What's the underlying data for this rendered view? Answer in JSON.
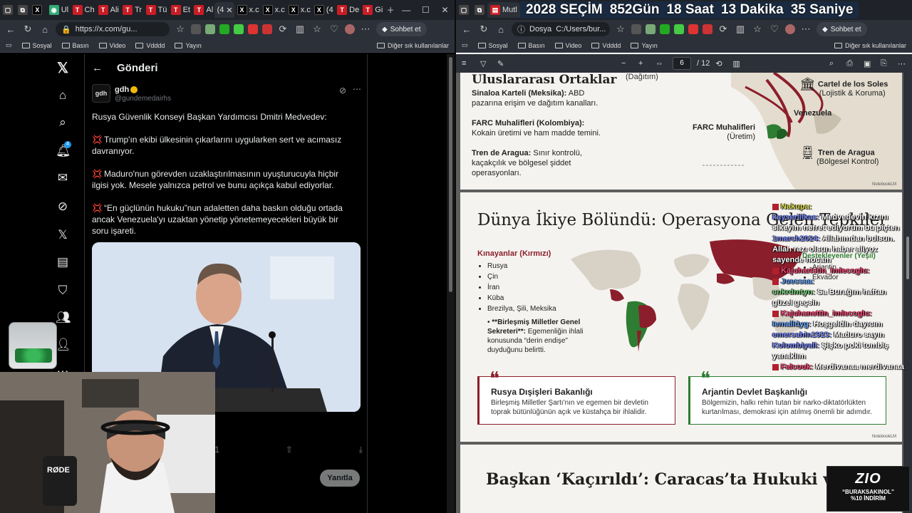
{
  "left_browser": {
    "tabs": [
      "",
      "",
      "Ul",
      "Ch",
      "Ali",
      "Tr",
      "Tü",
      "Et",
      "Al",
      "(4",
      "x.c",
      "x.c",
      "x.c",
      "(4",
      "De",
      "Gi"
    ],
    "address": "https://x.com/gu...",
    "copilot": "Sohbet et",
    "bookmarks": [
      "Sosyal",
      "Basın",
      "Video",
      "Vdddd",
      "Yayın"
    ],
    "bookmarks_other": "Diğer sık kullanılanlar"
  },
  "x_post": {
    "header_title": "Gönderi",
    "avatar_text": "gdh",
    "user_name": "gdh",
    "user_handle": "@gundemedairhs",
    "notification_badge": "4",
    "intro": "Rusya Güvenlik Konseyi Başkan Yardımcısı Dmitri Medvedev:",
    "p1": "Trump'ın ekibi ülkesinin çıkarlarını uygularken sert ve acımasız davranıyor.",
    "p2": "Maduro'nun görevden uzaklaştırılmasının uyuşturucuyla hiçbir ilgisi yok. Mesele yalnızca petrol ve bunu açıkça kabul ediyorlar.",
    "p3": "“En güçlünün hukuku”nun adaletten daha baskın olduğu ortada ancak Venezuela'yı uzaktan yönetip yönetemeyecekleri büyük bir soru işareti.",
    "bookmark_count": "1",
    "reply_button": "Yanıtla"
  },
  "right_browser": {
    "tab": "Mutl",
    "countdown": {
      "year": "2028",
      "label": "SEÇİM",
      "days": "852",
      "days_unit": "Gün",
      "hours": "18",
      "hours_unit": "Saat",
      "minutes": "13",
      "minutes_unit": "Dakika",
      "seconds": "35",
      "seconds_unit": "Saniye"
    },
    "address_label": "Dosya",
    "address": "C:/Users/bur...",
    "copilot": "Sohbet et",
    "bookmarks": [
      "Sosyal",
      "Basın",
      "Video",
      "Vdddd",
      "Yayın"
    ],
    "bookmarks_other": "Diğer sık kullanılanlar",
    "page_current": "6",
    "page_total": "/ 12"
  },
  "pdf": {
    "slide1": {
      "heading": "Uluslararası Ortaklar",
      "distrib_label": "(Dağıtım)",
      "items": [
        {
          "title": "Sinaloa Karteli (Meksika):",
          "text": "ABD pazarına erişim ve dağıtım kanalları."
        },
        {
          "title": "FARC Muhalifleri (Kolombiya):",
          "text": "Kokain üretimi ve ham madde temini."
        },
        {
          "title": "Tren de Aragua:",
          "text": "Sınır kontrolü, kaçakçılık ve bölgesel şiddet operasyonları."
        }
      ],
      "cartel": "Cartel de los Soles",
      "cartel_sub": "(Lojistik & Koruma)",
      "venezuela": "Venezuela",
      "farc": "FARC Muhalifleri",
      "farc_sub": "(Üretim)",
      "tren": "Tren de Aragua",
      "tren_sub": "(Bölgesel Kontrol)",
      "brand": "NotebookLM"
    },
    "slide2": {
      "title": "Dünya İkiye Bölündü: Operasyona Gelen Tepkiler",
      "condemn_heading": "Kınayanlar (Kırmızı)",
      "condemn_list": [
        "Rusya",
        "Çin",
        "İran",
        "Küba",
        "Brezilya, Şili, Meksika"
      ],
      "un_title": "**Birleşmiş Milletler Genel Sekreteri**:",
      "un_text": "Egemenliğin ihlali konusunda “derin endişe” duyduğunu belirtti.",
      "support_heading": "Destekleyenler (Yeşil)",
      "support_list": [
        "Arjantin",
        "Ekvador"
      ],
      "quote1_title": "Rusya Dışişleri Bakanlığı",
      "quote1_text": "Birleşmiş Milletler Şartı'nın ve egemen bir devletin toprak bütünlüğünün açık ve küstahça bir ihlalidir.",
      "quote2_title": "Arjantin Devlet Başkanlığı",
      "quote2_text": "Bölgemizin, halkı rehin tutan bir narko-diktatörlükten kurtarılması, demokrasi için atılmış önemli bir adımdır.",
      "brand": "NotebookLM"
    },
    "slide3": {
      "title": "Başkan ‘Kaçırıldı’: Caracas’ta Hukuki ve Siyasi"
    }
  },
  "chat": [
    {
      "user": "Nakupa:",
      "msg": "",
      "color": "cy"
    },
    {
      "user": "kayserilikas:",
      "msg": "Medvedevin kızını sikeyim nefret ediyorum bu piçten",
      "color": "cu"
    },
    {
      "user": "1march2024:",
      "msg": "Allahımdan bulsun. Allah razı olsun haber aliyoz sayende hocam",
      "color": "cu"
    },
    {
      "user": "Kajuharistin_imlecoglu:",
      "msg": "",
      "color": "cr"
    },
    {
      "user": "Juessaa:",
      "msg": "",
      "color": "cb"
    },
    {
      "user": "cnkrdmtyn:",
      "msg": "Sa Burağım haftan güzel geçsin",
      "color": "cg"
    },
    {
      "user": "Kajuhanettin_imlecoglu:",
      "msg": "",
      "color": "cr"
    },
    {
      "user": "Iemalldyg:",
      "msg": "Hoşgeldin dayıcım",
      "color": "cb"
    },
    {
      "user": "emersahin1923:",
      "msg": "Maduro sayın",
      "color": "cu"
    },
    {
      "user": "Kolombiyali:",
      "msg": "Şişko poki tombiş yanaklım",
      "color": "cu"
    },
    {
      "user": "Falcouk:",
      "msg": "Merdivanaa merdivanaa",
      "color": "cr"
    }
  ],
  "promo": {
    "logo": "ZIO",
    "code": "“BURAKSAKINOL”",
    "discount": "%10 İNDİRİM"
  },
  "webcam": {
    "mic_label": "RØDE"
  },
  "colors": {
    "x_bg": "#000000",
    "accent_red": "#8b1e2b",
    "support_green": "#2e7d32",
    "reply_button": "#787a7a"
  }
}
